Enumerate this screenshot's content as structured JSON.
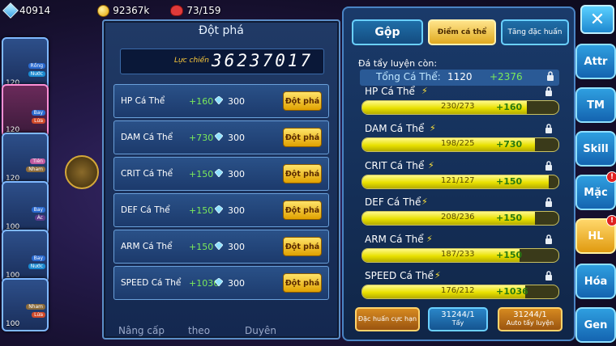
{
  "resources": {
    "gems": "40914",
    "gold": "92367k",
    "food": "73/159"
  },
  "pets": [
    {
      "level": "120",
      "tag1": "Rồng",
      "tag2": "Nước"
    },
    {
      "level": "120",
      "tag1": "Bay",
      "tag2": "Lửa"
    },
    {
      "level": "120",
      "tag1": "Tiên",
      "tag2": "Nham"
    },
    {
      "level": "100",
      "tag1": "Bay",
      "tag2": "Ác"
    },
    {
      "level": "100",
      "tag1": "Bay",
      "tag2": "Nước"
    },
    {
      "level": "100",
      "tag1": "Nham",
      "tag2": "Lửa"
    }
  ],
  "left_panel": {
    "title": "Đột phá",
    "power_label": "Lực chiến",
    "power_value": "36237017",
    "rows": [
      {
        "name": "HP Cá Thể",
        "bonus": "+160",
        "cost": "300",
        "button": "Đột phá"
      },
      {
        "name": "DAM Cá Thể",
        "bonus": "+730",
        "cost": "300",
        "button": "Đột phá"
      },
      {
        "name": "CRIT Cá Thể",
        "bonus": "+150",
        "cost": "300",
        "button": "Đột phá"
      },
      {
        "name": "DEF Cá Thể",
        "bonus": "+150",
        "cost": "300",
        "button": "Đột phá"
      },
      {
        "name": "ARM Cá Thể",
        "bonus": "+150",
        "cost": "300",
        "button": "Đột phá"
      },
      {
        "name": "SPEED Cá Thể",
        "bonus": "+1036",
        "cost": "300",
        "button": "Đột phá"
      }
    ]
  },
  "bottom_tabs": [
    "Nâng cấp",
    "theo",
    "Duyên"
  ],
  "right_panel": {
    "tabs": [
      "Gộp",
      "Điểm cá thể",
      "Tăng đặc huấn"
    ],
    "subtitle": "Đá tẩy luyện còn:",
    "total": {
      "label": "Tổng Cá Thể:",
      "value": "1120",
      "plus": "+2376"
    },
    "stats": [
      {
        "name": "HP Cá Thể",
        "current": "230/273",
        "plus": "+160",
        "fill": 0.84
      },
      {
        "name": "DAM Cá Thể",
        "current": "198/225",
        "plus": "+730",
        "fill": 0.88
      },
      {
        "name": "CRIT Cá Thể",
        "current": "121/127",
        "plus": "+150",
        "fill": 0.95
      },
      {
        "name": "DEF Cá Thể",
        "current": "208/236",
        "plus": "+150",
        "fill": 0.88
      },
      {
        "name": "ARM Cá Thể",
        "current": "187/233",
        "plus": "+150",
        "fill": 0.8
      },
      {
        "name": "SPEED Cá Thể",
        "current": "176/212",
        "plus": "+1036",
        "fill": 0.83
      }
    ],
    "actions": {
      "special": "Đặc huấn cực hạn",
      "wash_count": "31244/1",
      "wash_label": "Tẩy",
      "auto_count": "31244/1",
      "auto_label": "Auto tẩy luyện"
    }
  },
  "side_buttons": [
    "Attr",
    "TM",
    "Skill",
    "Mặc",
    "HL",
    "Hóa",
    "Gen"
  ],
  "side_badges": {
    "Mặc": "!",
    "HL": "!"
  },
  "close_label": "✕"
}
